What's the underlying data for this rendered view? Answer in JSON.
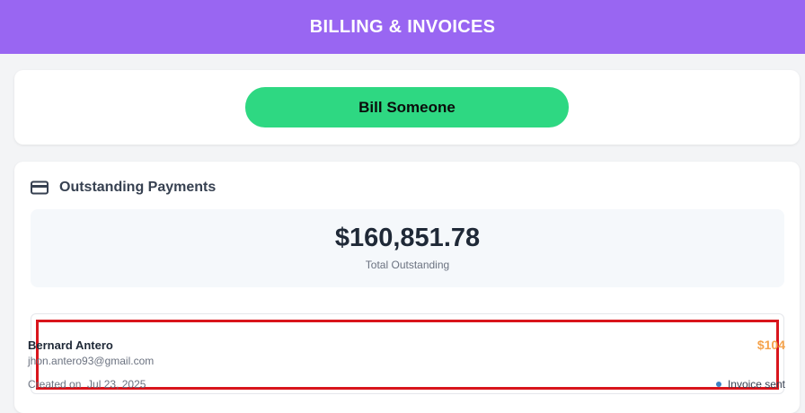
{
  "header": {
    "title": "BILLING & INVOICES"
  },
  "actions": {
    "bill_button_label": "Bill Someone"
  },
  "outstanding": {
    "section_title": "Outstanding Payments",
    "section_icon": "credit-card-icon",
    "total_amount": "$160,851.78",
    "total_label": "Total Outstanding"
  },
  "invoices": [
    {
      "name": "Bernard Antero",
      "email": "jhon.antero93@gmail.com",
      "created_label": "Created on",
      "created_date": "Jul 23, 2025",
      "amount": "$104",
      "status": "Invoice sent"
    }
  ],
  "colors": {
    "header_bg": "#9966f2",
    "bill_button_bg": "#2ed882",
    "amount_color": "#f5a34c",
    "status_dot": "#3b82c4",
    "highlight_border": "#d9151c"
  }
}
